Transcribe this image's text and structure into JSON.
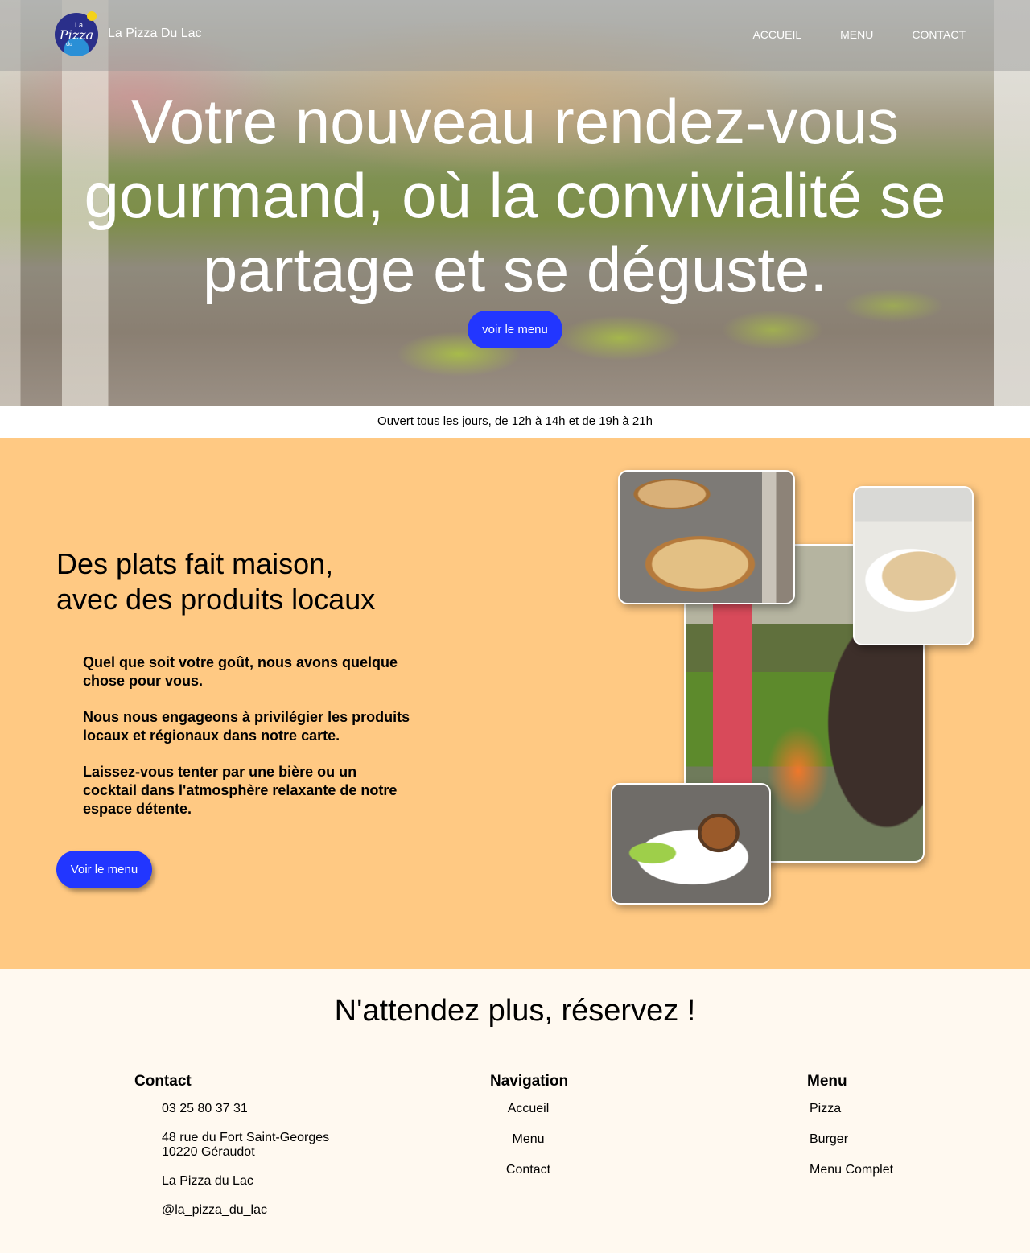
{
  "header": {
    "logo_text": [
      "La",
      "Pizza",
      "du"
    ],
    "brand": "La Pizza Du Lac",
    "nav": [
      "ACCUEIL",
      "MENU",
      "CONTACT"
    ]
  },
  "hero": {
    "title": "Votre nouveau rendez-vous gourmand, où la convivialité se partage et se déguste.",
    "button": "voir le menu"
  },
  "hours": "Ouvert tous les jours, de 12h à 14h et de 19h à 21h",
  "feature": {
    "title_line1": "Des plats fait maison,",
    "title_line2": "avec des produits locaux",
    "paragraphs": [
      "Quel que soit votre goût, nous avons quelque chose pour vous.",
      "Nous nous engageons à privilégier les produits locaux et régionaux dans notre carte.",
      "Laissez-vous tenter par une bière ou un cocktail dans l'atmosphère relaxante de notre espace détente."
    ],
    "button": "Voir le menu"
  },
  "reserve": {
    "title": "N'attendez plus, réservez !"
  },
  "footer": {
    "contact": {
      "heading": "Contact",
      "phone": "03 25 80 37 31",
      "address_line1": "48 rue du Fort Saint-Georges",
      "address_line2": "10220 Géraudot",
      "facebook": "La Pizza du Lac",
      "instagram": "@la_pizza_du_lac"
    },
    "navigation": {
      "heading": "Navigation",
      "items": [
        "Accueil",
        "Menu",
        "Contact"
      ]
    },
    "menu": {
      "heading": "Menu",
      "items": [
        "Pizza",
        "Burger",
        "Menu Complet"
      ]
    }
  },
  "colors": {
    "accent_button": "#2236ff",
    "feature_bg": "#ffc983",
    "footer_bg": "#fff9f0"
  }
}
